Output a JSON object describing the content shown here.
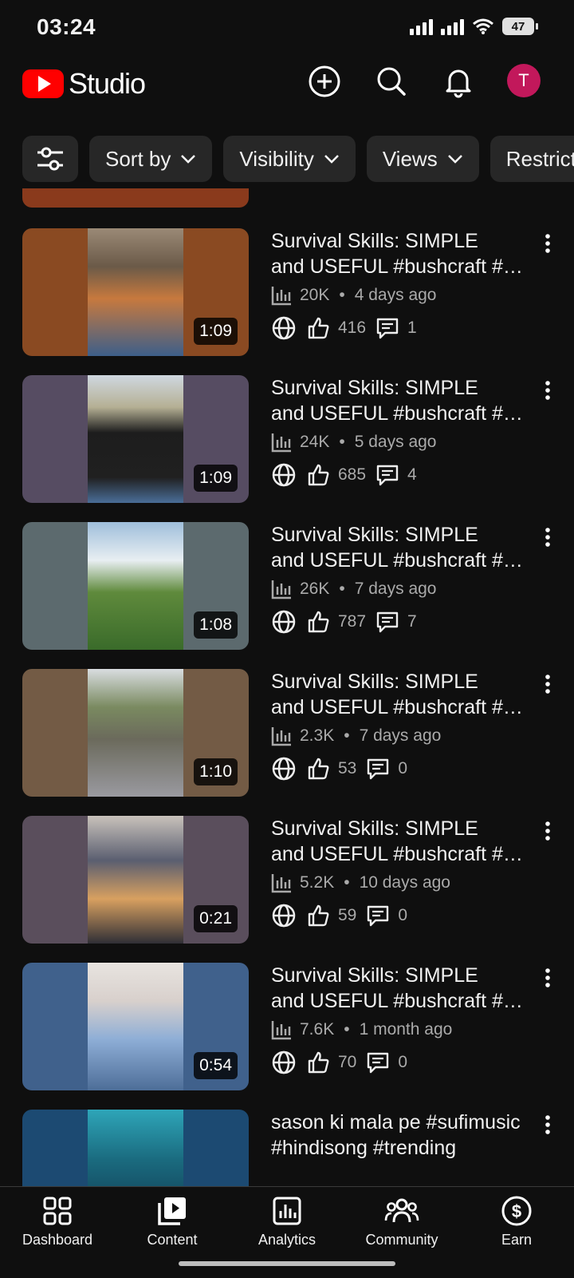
{
  "status_bar": {
    "time": "03:24",
    "battery": "47"
  },
  "header": {
    "app_name": "Studio",
    "avatar_initial": "T"
  },
  "filters": [
    {
      "label": "Sort by"
    },
    {
      "label": "Visibility"
    },
    {
      "label": "Views"
    },
    {
      "label": "Restrict"
    }
  ],
  "videos": [
    {
      "title_line1": "Survival Skills: SIMPLE",
      "title_line2": "and USEFUL #bushcraft #…",
      "views": "20K",
      "age": "4 days ago",
      "likes": "416",
      "comments": "1",
      "duration": "1:09"
    },
    {
      "title_line1": "Survival Skills: SIMPLE",
      "title_line2": "and USEFUL #bushcraft #…",
      "views": "24K",
      "age": "5 days ago",
      "likes": "685",
      "comments": "4",
      "duration": "1:09"
    },
    {
      "title_line1": "Survival Skills: SIMPLE",
      "title_line2": "and USEFUL #bushcraft #…",
      "views": "26K",
      "age": "7 days ago",
      "likes": "787",
      "comments": "7",
      "duration": "1:08"
    },
    {
      "title_line1": "Survival Skills: SIMPLE",
      "title_line2": "and USEFUL #bushcraft #…",
      "views": "2.3K",
      "age": "7 days ago",
      "likes": "53",
      "comments": "0",
      "duration": "1:10"
    },
    {
      "title_line1": "Survival Skills: SIMPLE",
      "title_line2": "and USEFUL #bushcraft #…",
      "views": "5.2K",
      "age": "10 days ago",
      "likes": "59",
      "comments": "0",
      "duration": "0:21"
    },
    {
      "title_line1": "Survival Skills: SIMPLE",
      "title_line2": "and USEFUL #bushcraft #…",
      "views": "7.6K",
      "age": "1 month ago",
      "likes": "70",
      "comments": "0",
      "duration": "0:54"
    },
    {
      "title_line1": "sason ki mala pe #sufimusic",
      "title_line2": "#hindisong #trending"
    }
  ],
  "bottom_nav": [
    {
      "label": "Dashboard"
    },
    {
      "label": "Content"
    },
    {
      "label": "Analytics"
    },
    {
      "label": "Community"
    },
    {
      "label": "Earn"
    }
  ],
  "colors": {
    "background": "#0f0f0f",
    "chip": "#272727",
    "brand_red": "#ff0000",
    "avatar": "#c2185b",
    "secondary_text": "#aaaaaa"
  }
}
